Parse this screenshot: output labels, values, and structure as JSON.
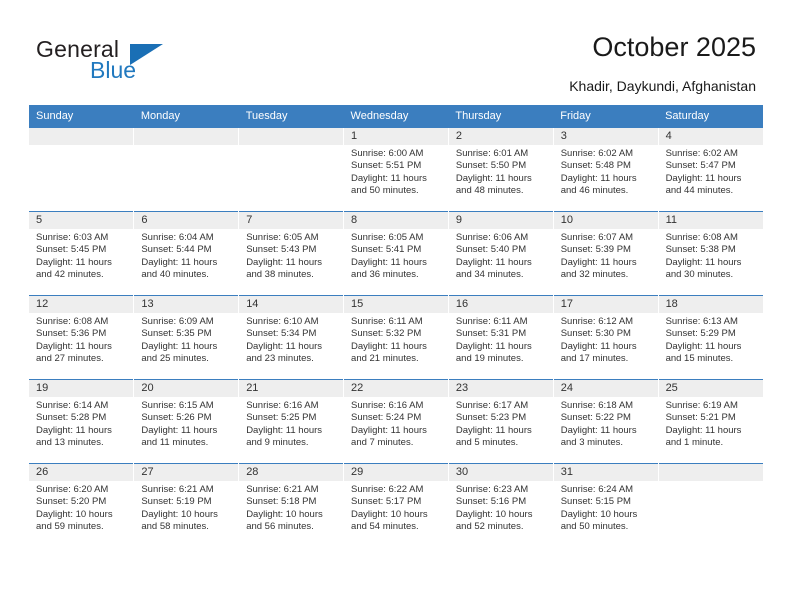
{
  "brand": {
    "word_one": "General",
    "word_two": "Blue",
    "triangle_icon": "triangle-logo-icon",
    "blue": "#2179bf"
  },
  "header": {
    "title": "October 2025",
    "subtitle": "Khadir, Daykundi, Afghanistan"
  },
  "calendar": {
    "header_bg": "#3b7ebf",
    "daynum_bg": "#eeeeee",
    "weekdays": [
      "Sunday",
      "Monday",
      "Tuesday",
      "Wednesday",
      "Thursday",
      "Friday",
      "Saturday"
    ],
    "weeks": [
      [
        {
          "day": "",
          "sunrise": "",
          "sunset": "",
          "daylight1": "",
          "daylight2": ""
        },
        {
          "day": "",
          "sunrise": "",
          "sunset": "",
          "daylight1": "",
          "daylight2": ""
        },
        {
          "day": "",
          "sunrise": "",
          "sunset": "",
          "daylight1": "",
          "daylight2": ""
        },
        {
          "day": "1",
          "sunrise": "Sunrise: 6:00 AM",
          "sunset": "Sunset: 5:51 PM",
          "daylight1": "Daylight: 11 hours",
          "daylight2": "and 50 minutes."
        },
        {
          "day": "2",
          "sunrise": "Sunrise: 6:01 AM",
          "sunset": "Sunset: 5:50 PM",
          "daylight1": "Daylight: 11 hours",
          "daylight2": "and 48 minutes."
        },
        {
          "day": "3",
          "sunrise": "Sunrise: 6:02 AM",
          "sunset": "Sunset: 5:48 PM",
          "daylight1": "Daylight: 11 hours",
          "daylight2": "and 46 minutes."
        },
        {
          "day": "4",
          "sunrise": "Sunrise: 6:02 AM",
          "sunset": "Sunset: 5:47 PM",
          "daylight1": "Daylight: 11 hours",
          "daylight2": "and 44 minutes."
        }
      ],
      [
        {
          "day": "5",
          "sunrise": "Sunrise: 6:03 AM",
          "sunset": "Sunset: 5:45 PM",
          "daylight1": "Daylight: 11 hours",
          "daylight2": "and 42 minutes."
        },
        {
          "day": "6",
          "sunrise": "Sunrise: 6:04 AM",
          "sunset": "Sunset: 5:44 PM",
          "daylight1": "Daylight: 11 hours",
          "daylight2": "and 40 minutes."
        },
        {
          "day": "7",
          "sunrise": "Sunrise: 6:05 AM",
          "sunset": "Sunset: 5:43 PM",
          "daylight1": "Daylight: 11 hours",
          "daylight2": "and 38 minutes."
        },
        {
          "day": "8",
          "sunrise": "Sunrise: 6:05 AM",
          "sunset": "Sunset: 5:41 PM",
          "daylight1": "Daylight: 11 hours",
          "daylight2": "and 36 minutes."
        },
        {
          "day": "9",
          "sunrise": "Sunrise: 6:06 AM",
          "sunset": "Sunset: 5:40 PM",
          "daylight1": "Daylight: 11 hours",
          "daylight2": "and 34 minutes."
        },
        {
          "day": "10",
          "sunrise": "Sunrise: 6:07 AM",
          "sunset": "Sunset: 5:39 PM",
          "daylight1": "Daylight: 11 hours",
          "daylight2": "and 32 minutes."
        },
        {
          "day": "11",
          "sunrise": "Sunrise: 6:08 AM",
          "sunset": "Sunset: 5:38 PM",
          "daylight1": "Daylight: 11 hours",
          "daylight2": "and 30 minutes."
        }
      ],
      [
        {
          "day": "12",
          "sunrise": "Sunrise: 6:08 AM",
          "sunset": "Sunset: 5:36 PM",
          "daylight1": "Daylight: 11 hours",
          "daylight2": "and 27 minutes."
        },
        {
          "day": "13",
          "sunrise": "Sunrise: 6:09 AM",
          "sunset": "Sunset: 5:35 PM",
          "daylight1": "Daylight: 11 hours",
          "daylight2": "and 25 minutes."
        },
        {
          "day": "14",
          "sunrise": "Sunrise: 6:10 AM",
          "sunset": "Sunset: 5:34 PM",
          "daylight1": "Daylight: 11 hours",
          "daylight2": "and 23 minutes."
        },
        {
          "day": "15",
          "sunrise": "Sunrise: 6:11 AM",
          "sunset": "Sunset: 5:32 PM",
          "daylight1": "Daylight: 11 hours",
          "daylight2": "and 21 minutes."
        },
        {
          "day": "16",
          "sunrise": "Sunrise: 6:11 AM",
          "sunset": "Sunset: 5:31 PM",
          "daylight1": "Daylight: 11 hours",
          "daylight2": "and 19 minutes."
        },
        {
          "day": "17",
          "sunrise": "Sunrise: 6:12 AM",
          "sunset": "Sunset: 5:30 PM",
          "daylight1": "Daylight: 11 hours",
          "daylight2": "and 17 minutes."
        },
        {
          "day": "18",
          "sunrise": "Sunrise: 6:13 AM",
          "sunset": "Sunset: 5:29 PM",
          "daylight1": "Daylight: 11 hours",
          "daylight2": "and 15 minutes."
        }
      ],
      [
        {
          "day": "19",
          "sunrise": "Sunrise: 6:14 AM",
          "sunset": "Sunset: 5:28 PM",
          "daylight1": "Daylight: 11 hours",
          "daylight2": "and 13 minutes."
        },
        {
          "day": "20",
          "sunrise": "Sunrise: 6:15 AM",
          "sunset": "Sunset: 5:26 PM",
          "daylight1": "Daylight: 11 hours",
          "daylight2": "and 11 minutes."
        },
        {
          "day": "21",
          "sunrise": "Sunrise: 6:16 AM",
          "sunset": "Sunset: 5:25 PM",
          "daylight1": "Daylight: 11 hours",
          "daylight2": "and 9 minutes."
        },
        {
          "day": "22",
          "sunrise": "Sunrise: 6:16 AM",
          "sunset": "Sunset: 5:24 PM",
          "daylight1": "Daylight: 11 hours",
          "daylight2": "and 7 minutes."
        },
        {
          "day": "23",
          "sunrise": "Sunrise: 6:17 AM",
          "sunset": "Sunset: 5:23 PM",
          "daylight1": "Daylight: 11 hours",
          "daylight2": "and 5 minutes."
        },
        {
          "day": "24",
          "sunrise": "Sunrise: 6:18 AM",
          "sunset": "Sunset: 5:22 PM",
          "daylight1": "Daylight: 11 hours",
          "daylight2": "and 3 minutes."
        },
        {
          "day": "25",
          "sunrise": "Sunrise: 6:19 AM",
          "sunset": "Sunset: 5:21 PM",
          "daylight1": "Daylight: 11 hours",
          "daylight2": "and 1 minute."
        }
      ],
      [
        {
          "day": "26",
          "sunrise": "Sunrise: 6:20 AM",
          "sunset": "Sunset: 5:20 PM",
          "daylight1": "Daylight: 10 hours",
          "daylight2": "and 59 minutes."
        },
        {
          "day": "27",
          "sunrise": "Sunrise: 6:21 AM",
          "sunset": "Sunset: 5:19 PM",
          "daylight1": "Daylight: 10 hours",
          "daylight2": "and 58 minutes."
        },
        {
          "day": "28",
          "sunrise": "Sunrise: 6:21 AM",
          "sunset": "Sunset: 5:18 PM",
          "daylight1": "Daylight: 10 hours",
          "daylight2": "and 56 minutes."
        },
        {
          "day": "29",
          "sunrise": "Sunrise: 6:22 AM",
          "sunset": "Sunset: 5:17 PM",
          "daylight1": "Daylight: 10 hours",
          "daylight2": "and 54 minutes."
        },
        {
          "day": "30",
          "sunrise": "Sunrise: 6:23 AM",
          "sunset": "Sunset: 5:16 PM",
          "daylight1": "Daylight: 10 hours",
          "daylight2": "and 52 minutes."
        },
        {
          "day": "31",
          "sunrise": "Sunrise: 6:24 AM",
          "sunset": "Sunset: 5:15 PM",
          "daylight1": "Daylight: 10 hours",
          "daylight2": "and 50 minutes."
        },
        {
          "day": "",
          "sunrise": "",
          "sunset": "",
          "daylight1": "",
          "daylight2": ""
        }
      ]
    ]
  }
}
